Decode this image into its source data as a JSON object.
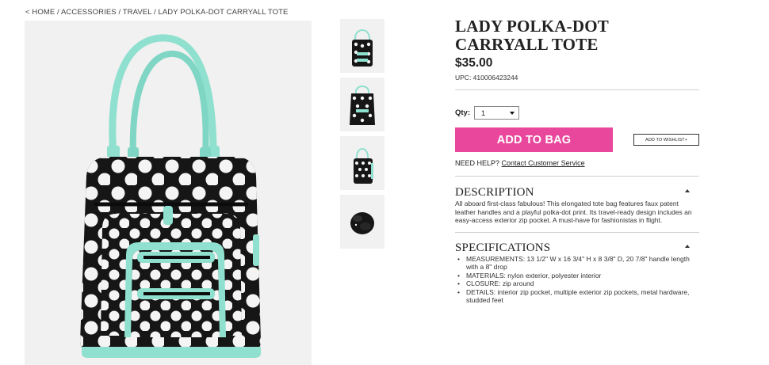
{
  "breadcrumb": "< HOME / ACCESSORIES / TRAVEL / LADY POLKA-DOT CARRYALL TOTE",
  "product": {
    "title": "LADY POLKA-DOT CARRYALL TOTE",
    "price": "$35.00",
    "upc": "UPC: 410006423244"
  },
  "purchase": {
    "qty_label": "Qty:",
    "qty_value": "1",
    "add_to_bag": "ADD TO BAG",
    "add_to_wishlist": "ADD TO WISHLIST+",
    "help_text": "NEED HELP?",
    "help_link": "Contact Customer Service"
  },
  "description": {
    "title": "DESCRIPTION",
    "text": "All aboard first-class fabulous! This elongated tote bag features faux patent leather handles and a playful polka-dot print. Its travel-ready design includes an easy-access exterior zip pocket. A must-have for fashionistas in flight."
  },
  "specifications": {
    "title": "SPECIFICATIONS",
    "items": [
      "MEASUREMENTS: 13 1/2\" W x 16 3/4\" H x 8 3/8\" D, 20 7/8\" handle length with a 8\" drop",
      "MATERIALS: nylon exterior, polyester interior",
      "CLOSURE: zip around",
      "DETAILS: interior zip pocket, multiple exterior zip pockets, metal hardware, studded feet"
    ]
  },
  "colors": {
    "accent_pink": "#e8479c",
    "mint": "#8fe0cf",
    "bag_black": "#161616"
  },
  "icons": {
    "qty_dropdown": "caret-down-icon",
    "description_toggle": "caret-up-icon",
    "specifications_toggle": "caret-up-icon"
  }
}
